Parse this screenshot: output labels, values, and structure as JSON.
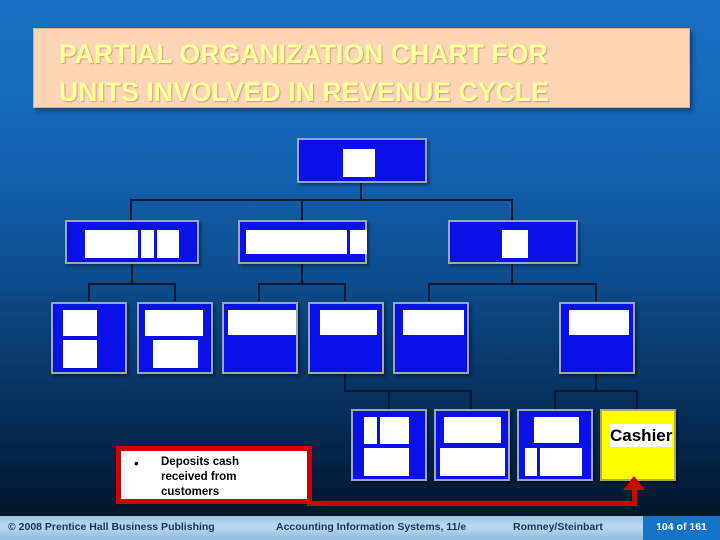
{
  "slide": {
    "title": "PARTIAL ORGANIZATION CHART FOR\nUNITS INVOLVED IN REVENUE CYCLE",
    "title_color": "#FFFF99",
    "title_bg": "#FBD5B5",
    "background_top": "#1A6FC4",
    "background_bottom": "#02101F"
  },
  "org_chart": {
    "box_fill": "#0A10E8",
    "box_border": "#9BA7BE",
    "connector_color": "#0A1830",
    "highlight_fill": "#FFFF00",
    "nodes": [
      {
        "id": "n1",
        "level": 1,
        "label": "",
        "redacted": true,
        "highlight": false
      },
      {
        "id": "n2",
        "level": 2,
        "label": "",
        "redacted": true,
        "highlight": false
      },
      {
        "id": "n3",
        "level": 2,
        "label": "",
        "redacted": true,
        "highlight": false
      },
      {
        "id": "n4",
        "level": 2,
        "label": "",
        "redacted": true,
        "highlight": false
      },
      {
        "id": "n5",
        "level": 3,
        "label": "",
        "redacted": true,
        "highlight": false
      },
      {
        "id": "n6",
        "level": 3,
        "label": "",
        "redacted": true,
        "highlight": false
      },
      {
        "id": "n7",
        "level": 3,
        "label": "",
        "redacted": true,
        "highlight": false
      },
      {
        "id": "n8",
        "level": 3,
        "label": "",
        "redacted": true,
        "highlight": false
      },
      {
        "id": "n9",
        "level": 3,
        "label": "",
        "redacted": true,
        "highlight": false
      },
      {
        "id": "n10",
        "level": 3,
        "label": "",
        "redacted": true,
        "highlight": false
      },
      {
        "id": "n11",
        "level": 4,
        "label": "",
        "redacted": true,
        "highlight": false
      },
      {
        "id": "n12",
        "level": 4,
        "label": "",
        "redacted": true,
        "highlight": false
      },
      {
        "id": "n13",
        "level": 4,
        "label": "",
        "redacted": true,
        "highlight": false
      },
      {
        "id": "n14",
        "level": 4,
        "label": "Cashier",
        "redacted": false,
        "highlight": true
      }
    ]
  },
  "callout": {
    "bullet": "•",
    "text": "Deposits cash\nreceived from\ncustomers",
    "border_color": "#D00000",
    "arrow_color": "#D00000",
    "arrow_target": "Cashier"
  },
  "footer": {
    "copyright": "© 2008 Prentice Hall Business Publishing",
    "center": "Accounting Information Systems, 11/e",
    "authors": "Romney/Steinbart",
    "page": "104 of 161",
    "badge_color": "#1574C8"
  }
}
